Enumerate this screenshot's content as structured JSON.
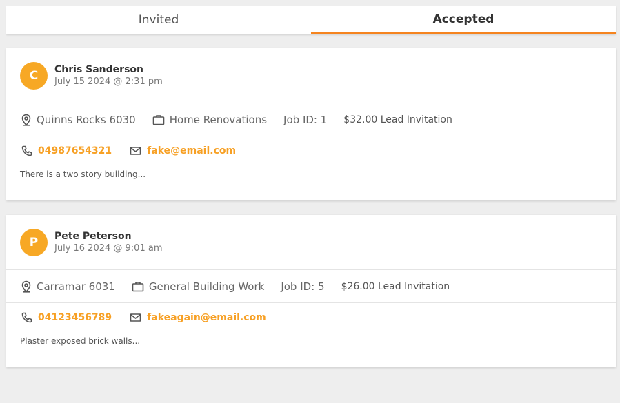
{
  "tabs": [
    {
      "label": "Invited",
      "active": false
    },
    {
      "label": "Accepted",
      "active": true
    }
  ],
  "colors": {
    "accent": "#f5841f",
    "avatar": "#f7a825",
    "link": "#f7a024"
  },
  "leads": [
    {
      "initial": "C",
      "name": "Chris Sanderson",
      "date": "July 15 2024 @ 2:31 pm",
      "location": "Quinns Rocks 6030",
      "category": "Home Renovations",
      "job_id": "Job ID: 1",
      "lead": "$32.00 Lead Invitation",
      "phone": "04987654321",
      "email": "fake@email.com",
      "description": "There is a two story building..."
    },
    {
      "initial": "P",
      "name": "Pete Peterson",
      "date": "July 16 2024 @ 9:01 am",
      "location": "Carramar 6031",
      "category": "General Building Work",
      "job_id": "Job ID: 5",
      "lead": "$26.00 Lead Invitation",
      "phone": "04123456789",
      "email": "fakeagain@email.com",
      "description": "Plaster exposed brick walls..."
    }
  ],
  "icons": {
    "location": "map-pin-icon",
    "category": "briefcase-icon",
    "phone": "phone-icon",
    "email": "mail-icon"
  }
}
